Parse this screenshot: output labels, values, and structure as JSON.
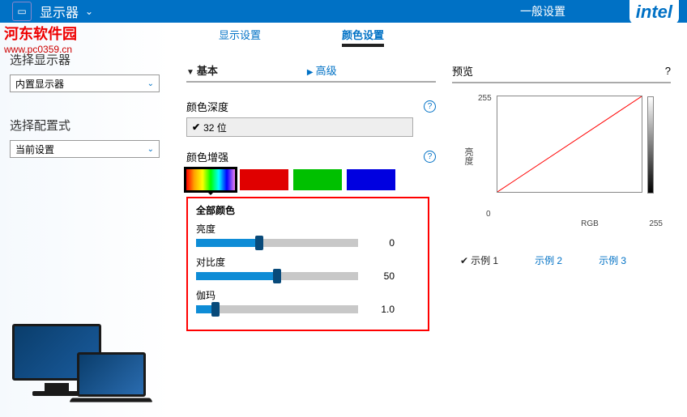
{
  "header": {
    "title": "显示器",
    "general": "一般设置",
    "logo": "intel"
  },
  "watermark": {
    "line1": "河东软件园",
    "line2": "www.pc0359.cn"
  },
  "left": {
    "select_display_label": "选择显示器",
    "select_display_value": "内置显示器",
    "profile_label": "选择配置式",
    "profile_value": "当前设置"
  },
  "tabs": {
    "display": "显示设置",
    "color": "颜色设置"
  },
  "subtabs": {
    "basic": "基本",
    "advanced": "高级"
  },
  "sections": {
    "color_depth": "颜色深度",
    "bit32": "32 位",
    "color_enhance": "颜色增强"
  },
  "sliders": {
    "group_title": "全部颜色",
    "brightness": {
      "label": "亮度",
      "value": "0",
      "percent": 39
    },
    "contrast": {
      "label": "对比度",
      "value": "50",
      "percent": 50
    },
    "gamma": {
      "label": "伽玛",
      "value": "1.0",
      "percent": 12
    }
  },
  "preview": {
    "title": "预览",
    "y_label": "亮度",
    "x_label": "RGB",
    "min": "0",
    "max": "255"
  },
  "examples": {
    "e1": "示例 1",
    "e2": "示例 2",
    "e3": "示例 3"
  }
}
